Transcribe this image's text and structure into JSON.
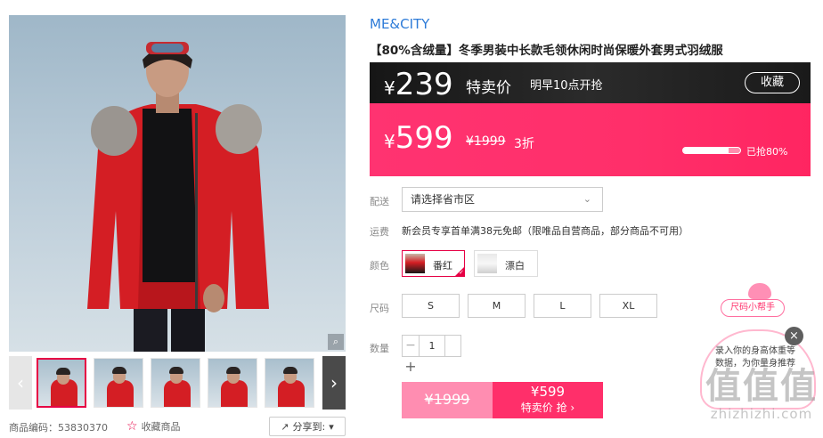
{
  "gallery": {
    "zoom_icon": "magnifier-icon",
    "prev_icon": "chevron-left-icon",
    "next_icon": "chevron-right-icon",
    "thumbnails": 6
  },
  "bottom_bar": {
    "code": "商品编码：53830370",
    "favorite": "收藏商品",
    "share": "分享到:",
    "share_caret": "▾"
  },
  "product": {
    "brand": "ME&CITY",
    "title": "【80%含绒量】冬季男装中长款毛领休闲时尚保暖外套男式羽绒服"
  },
  "flash": {
    "currency": "¥",
    "flash_price": "239",
    "tag": "特卖价",
    "time": "明早10点开抢",
    "remind_button": "收藏",
    "current_price": "599",
    "original_price": "¥1999",
    "discount": "3折",
    "sold_text": "已抢80%",
    "sold_fraction": 0.8
  },
  "options": {
    "shipping_label": "配送",
    "shipping_select": "请选择省市区",
    "fee_label": "运费",
    "fee_text": "新会员专享首单满38元免邮（限唯品自营商品，部分商品不可用）",
    "color_label": "颜色",
    "colors": [
      {
        "name": "番红",
        "selected": true
      },
      {
        "name": "漂白",
        "selected": false
      }
    ],
    "size_label": "尺码",
    "sizes": [
      "S",
      "M",
      "L",
      "XL"
    ],
    "qty_label": "数量",
    "qty_minus": "−",
    "qty_value": "1",
    "qty_plus": "+"
  },
  "buy": {
    "original": "¥1999",
    "flash_price": "¥599",
    "flash_label": "特卖价 抢 ›"
  },
  "helper": {
    "title": "尺码小帮手",
    "text": "录入你的身高体重等数据，为你量身推荐",
    "close": "×"
  },
  "watermark": {
    "logo": "值值值",
    "text": "zhizhizhi.com"
  },
  "colors": {
    "brand_blue": "#2d7bd8",
    "accent_pink": "#ff2f6a",
    "dark_bar": "#1a1a1a"
  }
}
